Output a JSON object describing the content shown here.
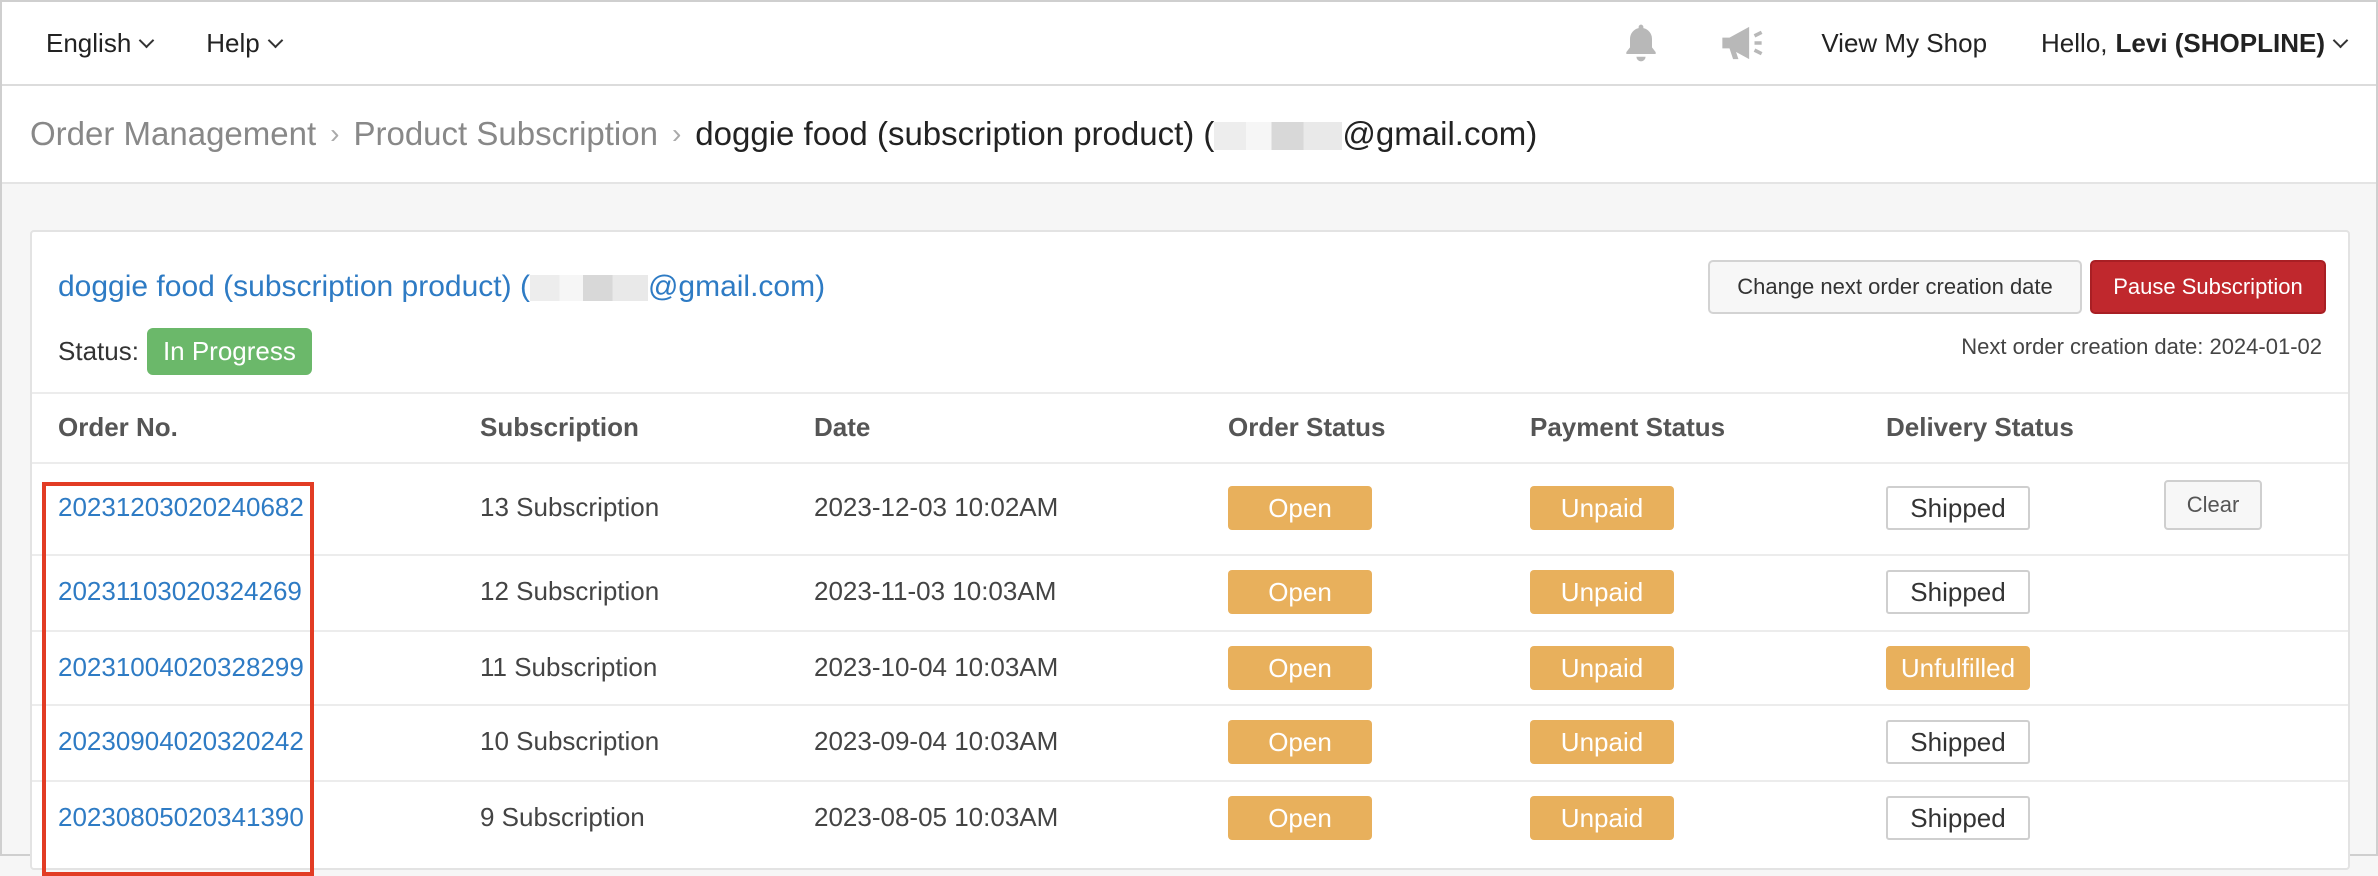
{
  "topbar": {
    "language": "English",
    "help": "Help",
    "view_shop": "View My Shop",
    "hello_prefix": "Hello,",
    "hello_user": "Levi (SHOPLINE)"
  },
  "breadcrumb": {
    "items": [
      "Order Management",
      "Product Subscription"
    ],
    "current_prefix": "doggie food (subscription product) (",
    "current_suffix": "@gmail.com)"
  },
  "card": {
    "title_prefix": "doggie food (subscription product) (",
    "title_suffix": "@gmail.com)",
    "status_label": "Status:",
    "status_value": "In Progress",
    "change_button": "Change next order creation date",
    "pause_button": "Pause Subscription",
    "next_order_date": "Next order creation date: 2024-01-02"
  },
  "table": {
    "headers": [
      "Order No.",
      "Subscription",
      "Date",
      "Order Status",
      "Payment Status",
      "Delivery Status"
    ],
    "clear_label": "Clear",
    "rows": [
      {
        "order_no": "20231203020240682",
        "subscription": "13 Subscription",
        "date": "2023-12-03 10:02AM",
        "order_status": "Open",
        "payment_status": "Unpaid",
        "delivery_status": "Shipped"
      },
      {
        "order_no": "20231103020324269",
        "subscription": "12 Subscription",
        "date": "2023-11-03 10:03AM",
        "order_status": "Open",
        "payment_status": "Unpaid",
        "delivery_status": "Shipped"
      },
      {
        "order_no": "20231004020328299",
        "subscription": "11 Subscription",
        "date": "2023-10-04 10:03AM",
        "order_status": "Open",
        "payment_status": "Unpaid",
        "delivery_status": "Unfulfilled"
      },
      {
        "order_no": "20230904020320242",
        "subscription": "10 Subscription",
        "date": "2023-09-04 10:03AM",
        "order_status": "Open",
        "payment_status": "Unpaid",
        "delivery_status": "Shipped"
      },
      {
        "order_no": "20230805020341390",
        "subscription": "9 Subscription",
        "date": "2023-08-05 10:03AM",
        "order_status": "Open",
        "payment_status": "Unpaid",
        "delivery_status": "Shipped"
      }
    ]
  },
  "colors": {
    "link": "#2e7bc4",
    "status_progress": "#6bb86a",
    "pill_orange": "#e8b05c",
    "pause_red": "#c0282d",
    "highlight": "#e23c24"
  },
  "icons": [
    "chevron-down-icon",
    "bell-icon",
    "megaphone-icon"
  ]
}
